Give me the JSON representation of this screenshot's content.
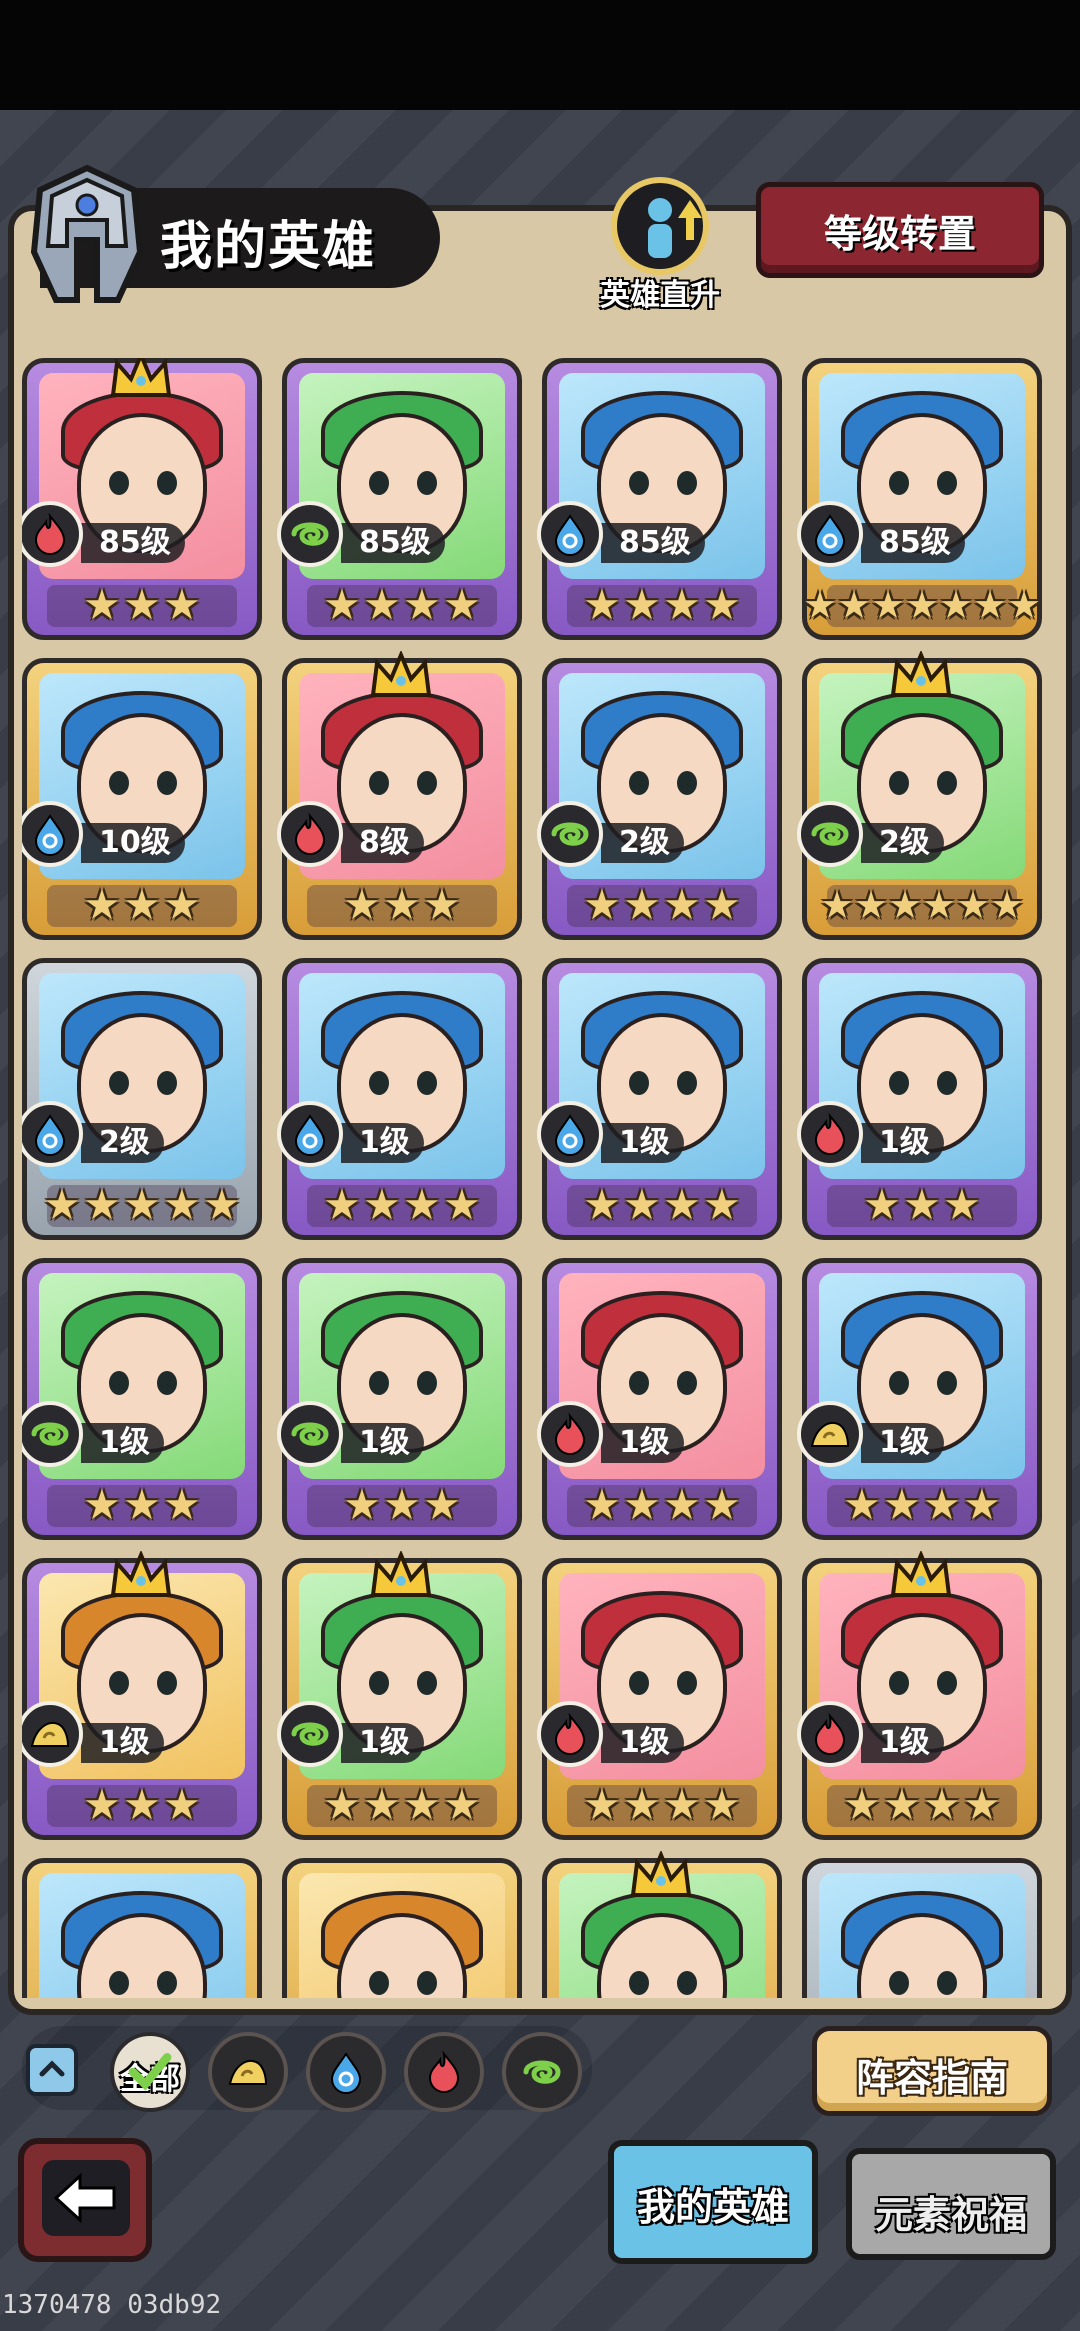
{
  "header": {
    "title": "我的英雄",
    "direct_upgrade_label": "英雄直升",
    "level_transfer_label": "等级转置"
  },
  "heroes": [
    {
      "level": "85级",
      "stars": 3,
      "element": "fire",
      "card": "purple",
      "portrait": "red",
      "crown": true
    },
    {
      "level": "85级",
      "stars": 4,
      "element": "wind",
      "card": "purple",
      "portrait": "green",
      "crown": false
    },
    {
      "level": "85级",
      "stars": 4,
      "element": "water",
      "card": "purple",
      "portrait": "blue",
      "crown": false
    },
    {
      "level": "85级",
      "stars": 7,
      "element": "water",
      "card": "gold",
      "portrait": "blue",
      "crown": false
    },
    {
      "level": "10级",
      "stars": 3,
      "element": "water",
      "card": "gold",
      "portrait": "blue",
      "crown": false
    },
    {
      "level": "8级",
      "stars": 3,
      "element": "fire",
      "card": "gold",
      "portrait": "red",
      "crown": true
    },
    {
      "level": "2级",
      "stars": 4,
      "element": "wind",
      "card": "purple",
      "portrait": "blue",
      "crown": false
    },
    {
      "level": "2级",
      "stars": 6,
      "element": "wind",
      "card": "gold",
      "portrait": "green",
      "crown": true
    },
    {
      "level": "2级",
      "stars": 5,
      "element": "water",
      "card": "gray",
      "portrait": "blue",
      "crown": false
    },
    {
      "level": "1级",
      "stars": 4,
      "element": "water",
      "card": "purple",
      "portrait": "blue",
      "crown": false
    },
    {
      "level": "1级",
      "stars": 4,
      "element": "water",
      "card": "purple",
      "portrait": "blue",
      "crown": false
    },
    {
      "level": "1级",
      "stars": 3,
      "element": "fire",
      "card": "purple",
      "portrait": "blue",
      "crown": false
    },
    {
      "level": "1级",
      "stars": 3,
      "element": "wind",
      "card": "purple",
      "portrait": "green",
      "crown": false
    },
    {
      "level": "1级",
      "stars": 3,
      "element": "wind",
      "card": "purple",
      "portrait": "green",
      "crown": false
    },
    {
      "level": "1级",
      "stars": 4,
      "element": "fire",
      "card": "purple",
      "portrait": "red",
      "crown": false
    },
    {
      "level": "1级",
      "stars": 4,
      "element": "earth",
      "card": "purple",
      "portrait": "blue",
      "crown": false
    },
    {
      "level": "1级",
      "stars": 3,
      "element": "earth",
      "card": "purple",
      "portrait": "gold",
      "crown": true
    },
    {
      "level": "1级",
      "stars": 4,
      "element": "wind",
      "card": "gold",
      "portrait": "green",
      "crown": true
    },
    {
      "level": "1级",
      "stars": 4,
      "element": "fire",
      "card": "gold",
      "portrait": "red",
      "crown": false
    },
    {
      "level": "1级",
      "stars": 4,
      "element": "fire",
      "card": "gold",
      "portrait": "red",
      "crown": true
    },
    {
      "level": "",
      "stars": 0,
      "element": "",
      "card": "gold",
      "portrait": "blue",
      "crown": false
    },
    {
      "level": "",
      "stars": 0,
      "element": "",
      "card": "gold",
      "portrait": "gold",
      "crown": false
    },
    {
      "level": "",
      "stars": 0,
      "element": "",
      "card": "gold",
      "portrait": "green",
      "crown": true
    },
    {
      "level": "",
      "stars": 0,
      "element": "",
      "card": "gray",
      "portrait": "blue",
      "crown": false
    }
  ],
  "filters": {
    "all_label": "全部",
    "elements": [
      "earth",
      "water",
      "fire",
      "wind"
    ]
  },
  "guide_label": "阵容指南",
  "tabs": {
    "my_heroes": "我的英雄",
    "element_blessing": "元素祝福"
  },
  "watermark": "1370478 03db92",
  "colors": {
    "fire": "#e8505a",
    "water": "#4aa8e8",
    "wind": "#7ed04a",
    "earth": "#f0d060"
  }
}
